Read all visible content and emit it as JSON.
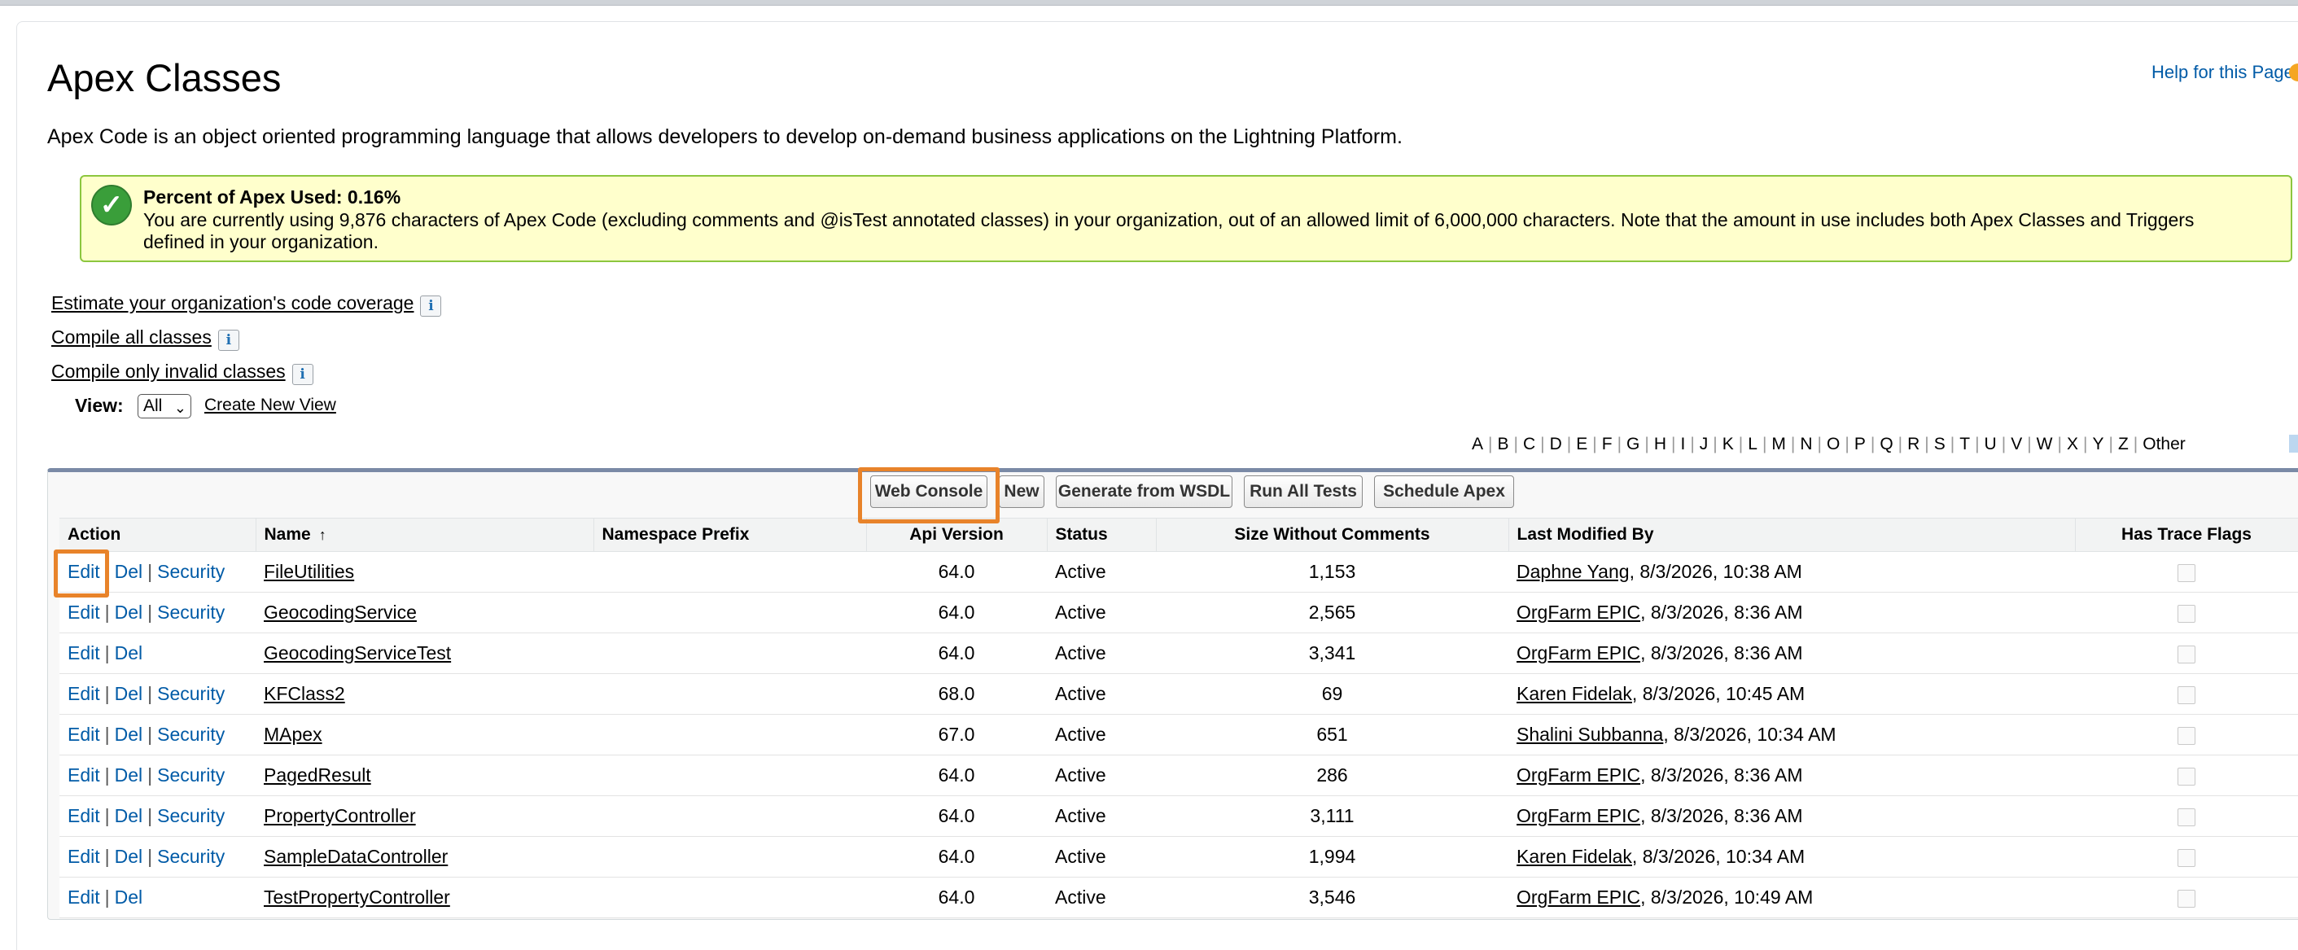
{
  "page": {
    "title": "Apex Classes",
    "help_link": "Help for this Page",
    "description": "Apex Code is an object oriented programming language that allows developers to develop on-demand business applications on the Lightning Platform."
  },
  "notice": {
    "title": "Percent of Apex Used: 0.16%",
    "text": "You are currently using 9,876 characters of Apex Code (excluding comments and @isTest annotated classes) in your organization, out of an allowed limit of 6,000,000 characters. Note that the amount in use includes both Apex Classes and Triggers defined in your organization."
  },
  "links": {
    "estimate": "Estimate your organization's code coverage",
    "compile_all": "Compile all classes",
    "compile_invalid": "Compile only invalid classes",
    "info_glyph": "i"
  },
  "view": {
    "label": "View:",
    "selected": "All",
    "create_new": "Create New View"
  },
  "alphabet": [
    "A",
    "B",
    "C",
    "D",
    "E",
    "F",
    "G",
    "H",
    "I",
    "J",
    "K",
    "L",
    "M",
    "N",
    "O",
    "P",
    "Q",
    "R",
    "S",
    "T",
    "U",
    "V",
    "W",
    "X",
    "Y",
    "Z",
    "Other"
  ],
  "toolbar": {
    "web_console": "Web Console",
    "new": "New",
    "generate_wsdl": "Generate from WSDL",
    "run_all_tests": "Run All Tests",
    "schedule_apex": "Schedule Apex"
  },
  "table": {
    "headers": {
      "action": "Action",
      "name": "Name",
      "sort_arrow": "↑",
      "namespace": "Namespace Prefix",
      "api_version": "Api Version",
      "status": "Status",
      "size": "Size Without Comments",
      "last_modified": "Last Modified By",
      "trace_flags": "Has Trace Flags"
    },
    "action_labels": {
      "edit": "Edit",
      "del": "Del",
      "security": "Security",
      "separator": "|"
    },
    "rows": [
      {
        "name": "FileUtilities",
        "namespace": "",
        "api": "64.0",
        "status": "Active",
        "size": "1,153",
        "modified_by": "Daphne Yang",
        "modified_at": ", 8/3/2026, 10:38 AM",
        "security": true
      },
      {
        "name": "GeocodingService",
        "namespace": "",
        "api": "64.0",
        "status": "Active",
        "size": "2,565",
        "modified_by": "OrgFarm EPIC",
        "modified_at": ", 8/3/2026, 8:36 AM",
        "security": true
      },
      {
        "name": "GeocodingServiceTest",
        "namespace": "",
        "api": "64.0",
        "status": "Active",
        "size": "3,341",
        "modified_by": "OrgFarm EPIC",
        "modified_at": ", 8/3/2026, 8:36 AM",
        "security": false
      },
      {
        "name": "KFClass2",
        "namespace": "",
        "api": "68.0",
        "status": "Active",
        "size": "69",
        "modified_by": "Karen Fidelak",
        "modified_at": ", 8/3/2026, 10:45 AM",
        "security": true
      },
      {
        "name": "MApex",
        "namespace": "",
        "api": "67.0",
        "status": "Active",
        "size": "651",
        "modified_by": "Shalini Subbanna",
        "modified_at": ", 8/3/2026, 10:34 AM",
        "security": true
      },
      {
        "name": "PagedResult",
        "namespace": "",
        "api": "64.0",
        "status": "Active",
        "size": "286",
        "modified_by": "OrgFarm EPIC",
        "modified_at": ", 8/3/2026, 8:36 AM",
        "security": true
      },
      {
        "name": "PropertyController",
        "namespace": "",
        "api": "64.0",
        "status": "Active",
        "size": "3,111",
        "modified_by": "OrgFarm EPIC",
        "modified_at": ", 8/3/2026, 8:36 AM",
        "security": true
      },
      {
        "name": "SampleDataController",
        "namespace": "",
        "api": "64.0",
        "status": "Active",
        "size": "1,994",
        "modified_by": "Karen Fidelak",
        "modified_at": ", 8/3/2026, 10:34 AM",
        "security": true
      },
      {
        "name": "TestPropertyController",
        "namespace": "",
        "api": "64.0",
        "status": "Active",
        "size": "3,546",
        "modified_by": "OrgFarm EPIC",
        "modified_at": ", 8/3/2026, 10:49 AM",
        "security": false
      }
    ]
  },
  "colors": {
    "link_blue": "#015ba7",
    "notice_bg": "#ffffcc",
    "notice_border": "#8cc63e",
    "highlight_orange": "#e8832a"
  },
  "icons": {
    "notice": "check-circle-icon",
    "info": "info-icon",
    "dropdown": "chevron-down-icon"
  }
}
